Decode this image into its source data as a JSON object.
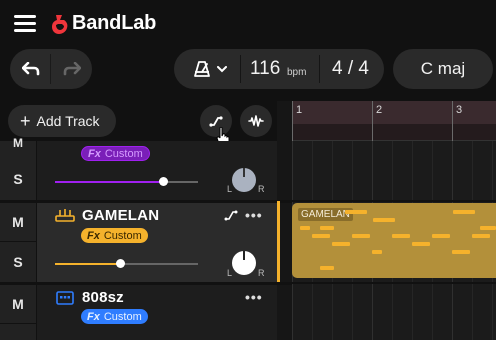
{
  "app": {
    "name": "BandLab"
  },
  "header": {
    "undo_icon": "undo-icon",
    "redo_icon": "redo-icon",
    "metronome_icon": "metronome-icon",
    "tempo_value": "116",
    "tempo_unit": "bpm",
    "time_signature": "4 / 4",
    "key": "C maj"
  },
  "toolbar": {
    "add_track_label": "Add Track",
    "automation_icon": "automation-icon",
    "waveform_icon": "waveform-icon"
  },
  "ruler": {
    "bars": [
      "1",
      "2",
      "3"
    ]
  },
  "tracks": [
    {
      "name": "",
      "fx_label": "Custom",
      "fx_prefix": "Fx",
      "accent": "#a020f0",
      "volume": 0.82,
      "mute_label": "M",
      "solo_label": "S"
    },
    {
      "name": "GAMELAN",
      "fx_label": "Custom",
      "fx_prefix": "Fx",
      "accent": "#f5b22c",
      "icon": "gamelan-instrument-icon",
      "volume": 0.49,
      "pan_left": "L",
      "pan_right": "R",
      "mute_label": "M",
      "solo_label": "S",
      "more": "•••",
      "clip_label": "GAMELAN"
    },
    {
      "name": "808sz",
      "fx_label": "Custom",
      "fx_prefix": "Fx",
      "accent": "#2f7dff",
      "icon": "drum-machine-icon",
      "mute_label": "M",
      "more": "•••"
    }
  ],
  "track0_pan": {
    "left": "L",
    "right": "R"
  }
}
